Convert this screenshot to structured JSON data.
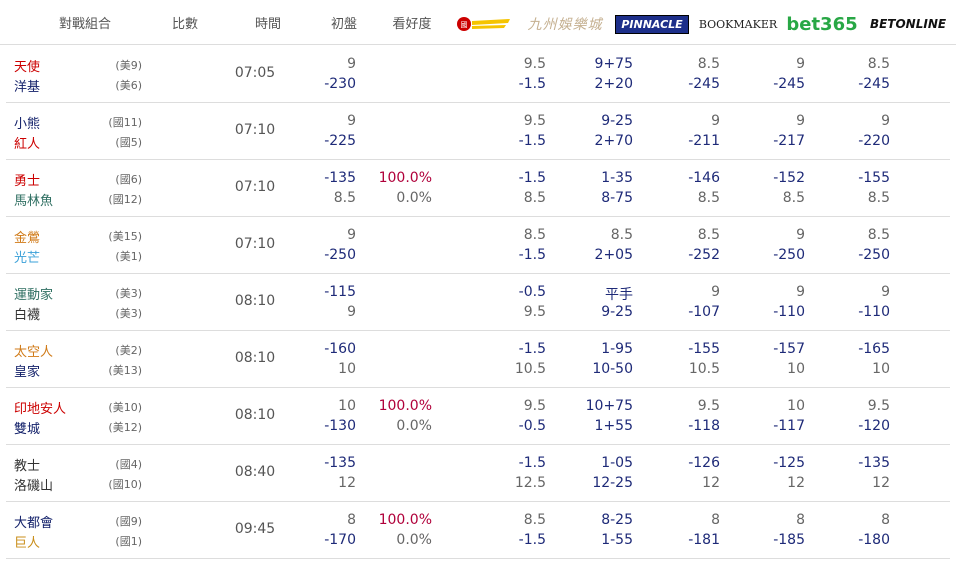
{
  "header": {
    "matchup": "對戰組合",
    "score": "比數",
    "time": "時間",
    "initial": "初盤",
    "confidence": "看好度",
    "books": [
      "(red logo)",
      "九州娛樂城",
      "PINNACLE",
      "BOOKMAKER",
      "bet365",
      "BETONLINE"
    ]
  },
  "games": [
    {
      "teams": [
        {
          "name": "天使",
          "rank": "(美9)",
          "color": "c-red"
        },
        {
          "name": "洋基",
          "rank": "(美6)",
          "color": "c-navy"
        }
      ],
      "time": "07:05",
      "initial": [
        "9",
        "-230"
      ],
      "confidence": [
        "",
        ""
      ],
      "odds": [
        [
          "9.5",
          "-1.5"
        ],
        [
          "9+75",
          "2+20"
        ],
        [
          "8.5",
          "-245"
        ],
        [
          "9",
          "-245"
        ],
        [
          "8.5",
          "-245"
        ]
      ]
    },
    {
      "teams": [
        {
          "name": "小熊",
          "rank": "(國11)",
          "color": "c-navy"
        },
        {
          "name": "紅人",
          "rank": "(國5)",
          "color": "c-red"
        }
      ],
      "time": "07:10",
      "initial": [
        "9",
        "-225"
      ],
      "confidence": [
        "",
        ""
      ],
      "odds": [
        [
          "9.5",
          "-1.5"
        ],
        [
          "9-25",
          "2+70"
        ],
        [
          "9",
          "-211"
        ],
        [
          "9",
          "-217"
        ],
        [
          "9",
          "-220"
        ]
      ]
    },
    {
      "teams": [
        {
          "name": "勇士",
          "rank": "(國6)",
          "color": "c-red"
        },
        {
          "name": "馬林魚",
          "rank": "(國12)",
          "color": "c-teal"
        }
      ],
      "time": "07:10",
      "initial": [
        "-135",
        "8.5"
      ],
      "confidence": [
        "100.0%",
        "0.0%"
      ],
      "odds": [
        [
          "-1.5",
          "8.5"
        ],
        [
          "1-35",
          "8-75"
        ],
        [
          "-146",
          "8.5"
        ],
        [
          "-152",
          "8.5"
        ],
        [
          "-155",
          "8.5"
        ]
      ]
    },
    {
      "teams": [
        {
          "name": "金鶯",
          "rank": "(美15)",
          "color": "c-orange"
        },
        {
          "name": "光芒",
          "rank": "(美1)",
          "color": "c-sky"
        }
      ],
      "time": "07:10",
      "initial": [
        "9",
        "-250"
      ],
      "confidence": [
        "",
        ""
      ],
      "odds": [
        [
          "8.5",
          "-1.5"
        ],
        [
          "8.5",
          "2+05"
        ],
        [
          "8.5",
          "-252"
        ],
        [
          "9",
          "-250"
        ],
        [
          "8.5",
          "-250"
        ]
      ]
    },
    {
      "teams": [
        {
          "name": "運動家",
          "rank": "(美3)",
          "color": "c-teal"
        },
        {
          "name": "白襪",
          "rank": "(美3)",
          "color": "c-dark"
        }
      ],
      "time": "08:10",
      "initial": [
        "-115",
        "9"
      ],
      "confidence": [
        "",
        ""
      ],
      "odds": [
        [
          "-0.5",
          "9.5"
        ],
        [
          "平手",
          "9-25"
        ],
        [
          "9",
          "-107"
        ],
        [
          "9",
          "-110"
        ],
        [
          "9",
          "-110"
        ]
      ]
    },
    {
      "teams": [
        {
          "name": "太空人",
          "rank": "(美2)",
          "color": "c-orange"
        },
        {
          "name": "皇家",
          "rank": "(美13)",
          "color": "c-navy"
        }
      ],
      "time": "08:10",
      "initial": [
        "-160",
        "10"
      ],
      "confidence": [
        "",
        ""
      ],
      "odds": [
        [
          "-1.5",
          "10.5"
        ],
        [
          "1-95",
          "10-50"
        ],
        [
          "-155",
          "10.5"
        ],
        [
          "-157",
          "10"
        ],
        [
          "-165",
          "10"
        ]
      ]
    },
    {
      "teams": [
        {
          "name": "印地安人",
          "rank": "(美10)",
          "color": "c-red"
        },
        {
          "name": "雙城",
          "rank": "(美12)",
          "color": "c-navy"
        }
      ],
      "time": "08:10",
      "initial": [
        "10",
        "-130"
      ],
      "confidence": [
        "100.0%",
        "0.0%"
      ],
      "odds": [
        [
          "9.5",
          "-0.5"
        ],
        [
          "10+75",
          "1+55"
        ],
        [
          "9.5",
          "-118"
        ],
        [
          "10",
          "-117"
        ],
        [
          "9.5",
          "-120"
        ]
      ]
    },
    {
      "teams": [
        {
          "name": "教士",
          "rank": "(國4)",
          "color": "c-dark"
        },
        {
          "name": "洛磯山",
          "rank": "(國10)",
          "color": "c-dark"
        }
      ],
      "time": "08:40",
      "initial": [
        "-135",
        "12"
      ],
      "confidence": [
        "",
        ""
      ],
      "odds": [
        [
          "-1.5",
          "12.5"
        ],
        [
          "1-05",
          "12-25"
        ],
        [
          "-126",
          "12"
        ],
        [
          "-125",
          "12"
        ],
        [
          "-135",
          "12"
        ]
      ]
    },
    {
      "teams": [
        {
          "name": "大都會",
          "rank": "(國9)",
          "color": "c-navy"
        },
        {
          "name": "巨人",
          "rank": "(國1)",
          "color": "c-gold"
        }
      ],
      "time": "09:45",
      "initial": [
        "8",
        "-170"
      ],
      "confidence": [
        "100.0%",
        "0.0%"
      ],
      "odds": [
        [
          "8.5",
          "-1.5"
        ],
        [
          "8-25",
          "1-55"
        ],
        [
          "8",
          "-181"
        ],
        [
          "8",
          "-185"
        ],
        [
          "8",
          "-180"
        ]
      ]
    }
  ]
}
